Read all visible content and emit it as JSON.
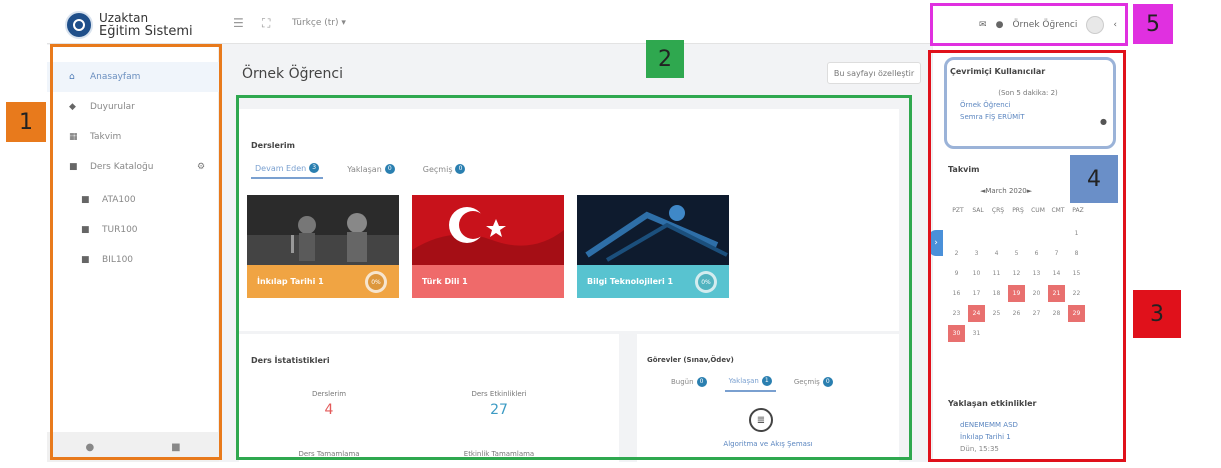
{
  "header": {
    "brand_line1": "Uzaktan",
    "brand_line2": "Eğitim Sistemi",
    "language": "Türkçe (tr) ▾",
    "user_name": "Örnek Öğrenci"
  },
  "sidebar": {
    "items": [
      {
        "label": "Anasayfam",
        "icon": "home-icon"
      },
      {
        "label": "Duyurular",
        "icon": "megaphone-icon"
      },
      {
        "label": "Takvim",
        "icon": "calendar-icon"
      },
      {
        "label": "Ders Kataloğu",
        "icon": "catalog-icon"
      },
      {
        "label": "ATA100",
        "icon": "folder-icon"
      },
      {
        "label": "TUR100",
        "icon": "folder-icon"
      },
      {
        "label": "BIL100",
        "icon": "folder-icon"
      }
    ]
  },
  "main": {
    "page_title": "Örnek Öğrenci",
    "customize_button": "Bu sayfayı özelleştir",
    "courses_title": "Derslerim",
    "tabs": [
      {
        "label": "Devam Eden",
        "count": "3"
      },
      {
        "label": "Yaklaşan",
        "count": "0"
      },
      {
        "label": "Geçmiş",
        "count": "0"
      }
    ],
    "courses": [
      {
        "name": "İnkılap Tarihi 1",
        "progress": "0%",
        "color": "#f0a443"
      },
      {
        "name": "Türk Dili 1",
        "progress": "0%",
        "color": "#ef6a6a"
      },
      {
        "name": "Bilgi Teknolojileri 1",
        "progress": "0%",
        "color": "#58c3d0"
      }
    ],
    "stats_title": "Ders İstatistikleri",
    "stats": [
      {
        "label": "Derslerim",
        "value": "4"
      },
      {
        "label": "Ders Etkinlikleri",
        "value": "27"
      },
      {
        "label": "Ders Tamamlama",
        "value": ""
      },
      {
        "label": "Etkinlik Tamamlama",
        "value": ""
      }
    ],
    "tasks_title": "Görevler (Sınav,Ödev)",
    "task_tabs": [
      {
        "label": "Bugün",
        "count": "0"
      },
      {
        "label": "Yaklaşan",
        "count": "1"
      },
      {
        "label": "Geçmiş",
        "count": "0"
      }
    ],
    "task_link": "Algoritma ve Akış Şeması"
  },
  "right": {
    "online_title": "Çevrimiçi Kullanıcılar",
    "online_sub": "(Son 5 dakika: 2)",
    "online_users": [
      "Örnek Öğrenci",
      "Semra FİŞ ERÜMİT"
    ],
    "calendar_title": "Takvim",
    "calendar_month": "◄March 2020►",
    "weekdays": [
      "PZT",
      "SAL",
      "ÇRŞ",
      "PRŞ",
      "CUM",
      "CMT",
      "PAZ"
    ],
    "days": [
      "",
      "",
      "",
      "",
      "",
      "",
      "1",
      "2",
      "3",
      "4",
      "5",
      "6",
      "7",
      "8",
      "9",
      "10",
      "11",
      "12",
      "13",
      "14",
      "15",
      "16",
      "17",
      "18",
      "19",
      "20",
      "21",
      "22",
      "23",
      "24",
      "25",
      "26",
      "27",
      "28",
      "29",
      "30",
      "31"
    ],
    "event_days": [
      "19",
      "21",
      "24",
      "29",
      "30"
    ],
    "upcoming_title": "Yaklaşan etkinlikler",
    "event_name": "dENEMEMM ASD",
    "event_course": "İnkılap Tarihi 1",
    "event_time": "Dün, 15:35"
  },
  "annotations": [
    {
      "number": "1",
      "color": "#e87a1c"
    },
    {
      "number": "2",
      "color": "#2fa84f"
    },
    {
      "number": "3",
      "color": "#e0111b"
    },
    {
      "number": "4",
      "color": "#6a8fc8"
    },
    {
      "number": "5",
      "color": "#e030e0"
    }
  ]
}
